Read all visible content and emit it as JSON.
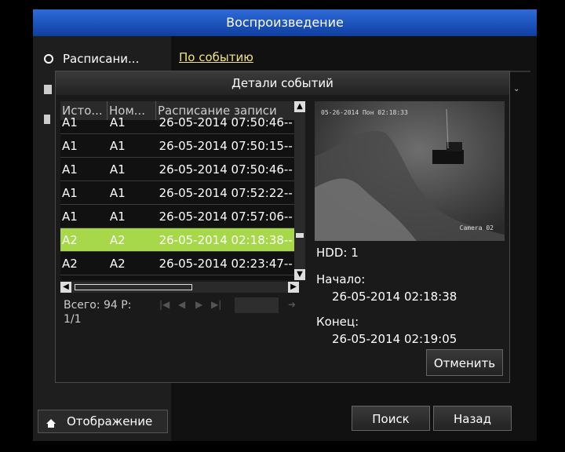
{
  "main": {
    "title": "Воспроизведение",
    "sidebar": {
      "item1": "Расписани...",
      "display_label": "Отображение"
    },
    "tab_event": "По событию",
    "search_label": "Поиск",
    "back_label": "Назад"
  },
  "dialog": {
    "title": "Детали событий",
    "columns": [
      "Исто...",
      "Ном...",
      "Расписание записи"
    ],
    "rows": [
      [
        "A1",
        "A1",
        "26-05-2014 07:50:46--"
      ],
      [
        "A1",
        "A1",
        "26-05-2014 07:50:15--"
      ],
      [
        "A1",
        "A1",
        "26-05-2014 07:50:46--"
      ],
      [
        "A1",
        "A1",
        "26-05-2014 07:52:22--"
      ],
      [
        "A1",
        "A1",
        "26-05-2014 07:57:06--"
      ],
      [
        "A2",
        "A2",
        "26-05-2014 02:18:38--"
      ],
      [
        "A2",
        "A2",
        "26-05-2014 02:23:47--"
      ]
    ],
    "selected_row": 5,
    "total_label": "Всего: 94  Р:",
    "page_label": "1/1",
    "preview_osd_date": "05-26-2014 Пон 02:18:33",
    "preview_osd_camera": "Camera 02",
    "hdd": "HDD: 1",
    "start_label": "Начало:",
    "start_value": "26-05-2014 02:18:38",
    "end_label": "Конец:",
    "end_value": "26-05-2014 02:19:05",
    "cancel_label": "Отменить"
  },
  "colors": {
    "title_bar": "#1f55c4",
    "selected_row": "#a6d84a",
    "tab_text": "#f4e37a"
  }
}
